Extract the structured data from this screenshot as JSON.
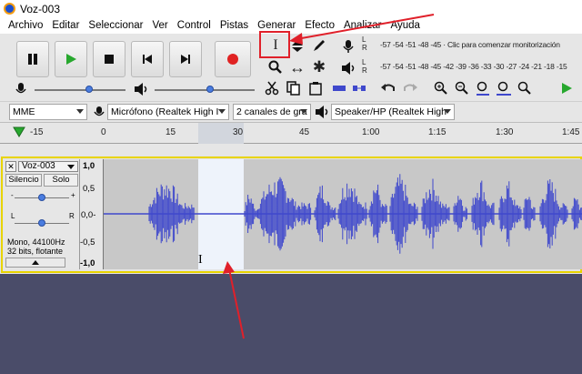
{
  "window": {
    "title": "Voz-003"
  },
  "menu": [
    "Archivo",
    "Editar",
    "Seleccionar",
    "Ver",
    "Control",
    "Pistas",
    "Generar",
    "Efecto",
    "Analizar",
    "Ayuda"
  ],
  "transport": {
    "pause": "pause-icon",
    "play": "play-icon",
    "stop": "stop-icon",
    "skip_start": "skip-start-icon",
    "skip_end": "skip-end-icon",
    "record": "record-icon"
  },
  "tools": {
    "selection": "I",
    "envelope": "envelope-icon",
    "draw": "pencil-icon",
    "zoom": "zoom-icon",
    "timeshift": "↔",
    "multi": "✱"
  },
  "meters": {
    "record_scale": "-57 -54 -51 -48 -45 · Clic para comenzar monitorización",
    "play_scale": "-57 -54 -51 -48 -45 -42 -39 -36 -33 -30 -27 -24 -21 -18 -15",
    "l": "L",
    "r": "R"
  },
  "devices": {
    "host": "MME",
    "mic": "Micrófono (Realtek High I",
    "channels": "2 canales de gra",
    "speaker": "Speaker/HP (Realtek High"
  },
  "ruler": {
    "ticks": [
      "-15",
      "0",
      "15",
      "30",
      "45",
      "1:00",
      "1:15",
      "1:30",
      "1:45"
    ]
  },
  "track": {
    "name": "Voz-003",
    "mute": "Silencio",
    "solo": "Solo",
    "l": "L",
    "r": "R",
    "info1": "Mono, 44100Hz",
    "info2": "32 bits, flotante",
    "scale": [
      "1,0",
      "0,5",
      "0,0-",
      "-0,5",
      "-1,0"
    ]
  },
  "colors": {
    "wave": "#3f48cc",
    "selection": "#eef3fb",
    "accent": "#e0202a",
    "bottom": "#4a4c69"
  }
}
